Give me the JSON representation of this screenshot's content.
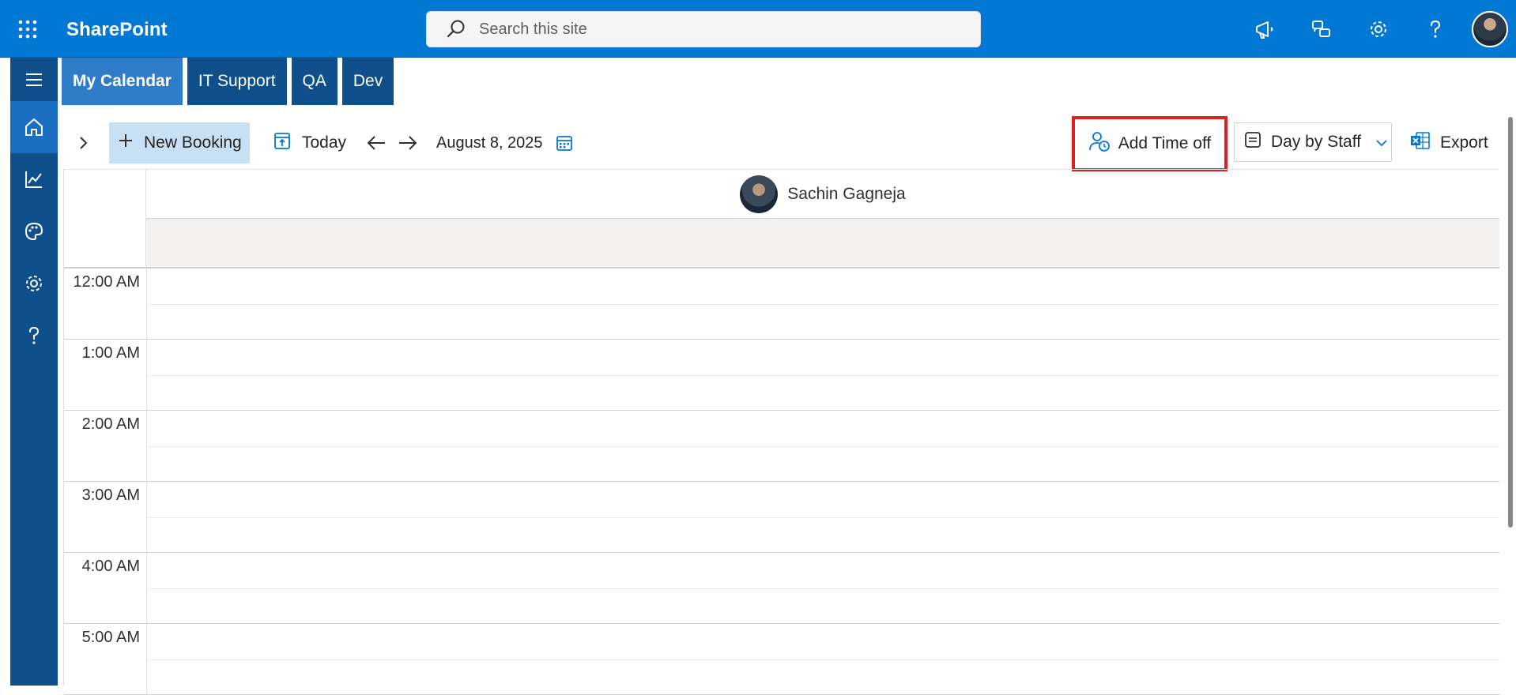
{
  "suitebar": {
    "brand": "SharePoint",
    "search_placeholder": "Search this site",
    "icons": [
      "waffle-icon",
      "megaphone-icon",
      "chat-icon",
      "gear-icon",
      "help-icon",
      "user-avatar"
    ]
  },
  "rail": {
    "items": [
      "menu-icon",
      "home-icon",
      "analytics-icon",
      "palette-icon",
      "settings-icon",
      "help-icon"
    ]
  },
  "tabs": [
    {
      "label": "My Calendar",
      "active": true
    },
    {
      "label": "IT Support",
      "active": false
    },
    {
      "label": "QA",
      "active": false
    },
    {
      "label": "Dev",
      "active": false
    }
  ],
  "toolbar": {
    "new_booking": "New Booking",
    "today": "Today",
    "date": "August 8, 2025",
    "add_time_off": "Add Time off",
    "view": "Day by Staff",
    "export": "Export"
  },
  "calendar": {
    "staff_name": "Sachin Gagneja",
    "hours": [
      "12:00 AM",
      "1:00 AM",
      "2:00 AM",
      "3:00 AM",
      "4:00 AM",
      "5:00 AM"
    ]
  },
  "colors": {
    "suitebar": "#0078d4",
    "rail": "#0f4f8c",
    "highlight_border": "#e02020",
    "new_booking_bg": "#c7e0f4"
  }
}
